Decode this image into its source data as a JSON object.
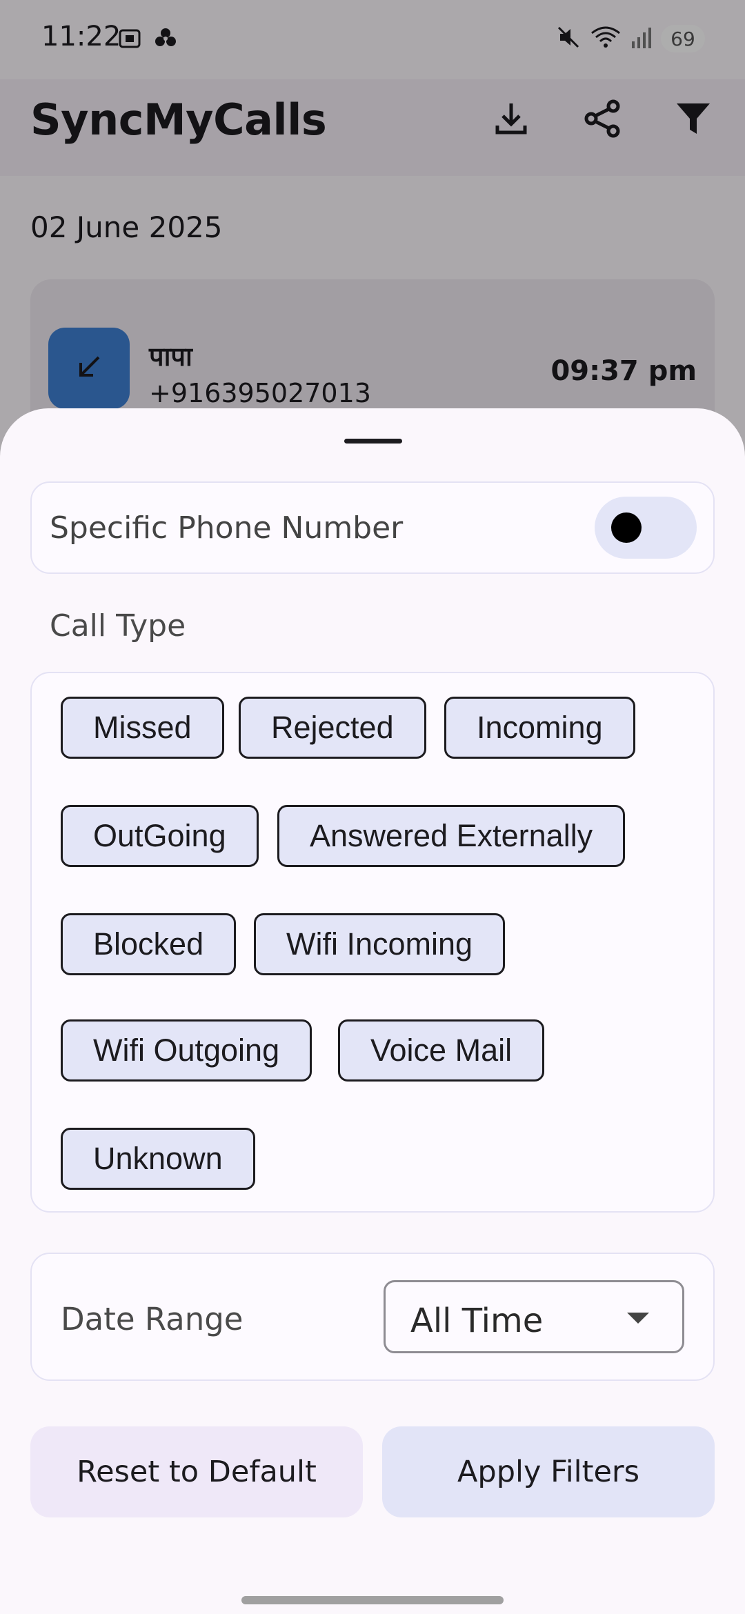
{
  "status_bar": {
    "time": "11:22",
    "battery": "69",
    "icons": [
      "screenshot-icon",
      "fan-icon",
      "mute-icon",
      "wifi-icon",
      "signal-icon"
    ]
  },
  "app_bar": {
    "title": "SyncMyCalls",
    "actions": [
      "download-icon",
      "share-icon",
      "filter-icon"
    ]
  },
  "call_log": {
    "date_header": "02 June 2025",
    "entries": [
      {
        "name": "पापा",
        "number": "+916395027013",
        "time": "09:37 pm",
        "type_icon": "incoming-arrow-icon",
        "type_color": "#3f7fd2"
      }
    ]
  },
  "filter_sheet": {
    "specific_phone": {
      "label": "Specific Phone Number",
      "enabled": false
    },
    "call_type_label": "Call Type",
    "call_types": [
      "Missed",
      "Rejected",
      "Incoming",
      "OutGoing",
      "Answered Externally",
      "Blocked",
      "Wifi Incoming",
      "Wifi Outgoing",
      "Voice Mail",
      "Unknown"
    ],
    "date_range": {
      "label": "Date Range",
      "selected": "All Time"
    },
    "buttons": {
      "reset": "Reset to Default",
      "apply": "Apply Filters"
    }
  },
  "colors": {
    "chip_bg": "#e3e5f7",
    "reset_bg": "#efe8f8",
    "apply_bg": "#e2e4f7",
    "avatar": "#3f7fd2"
  }
}
